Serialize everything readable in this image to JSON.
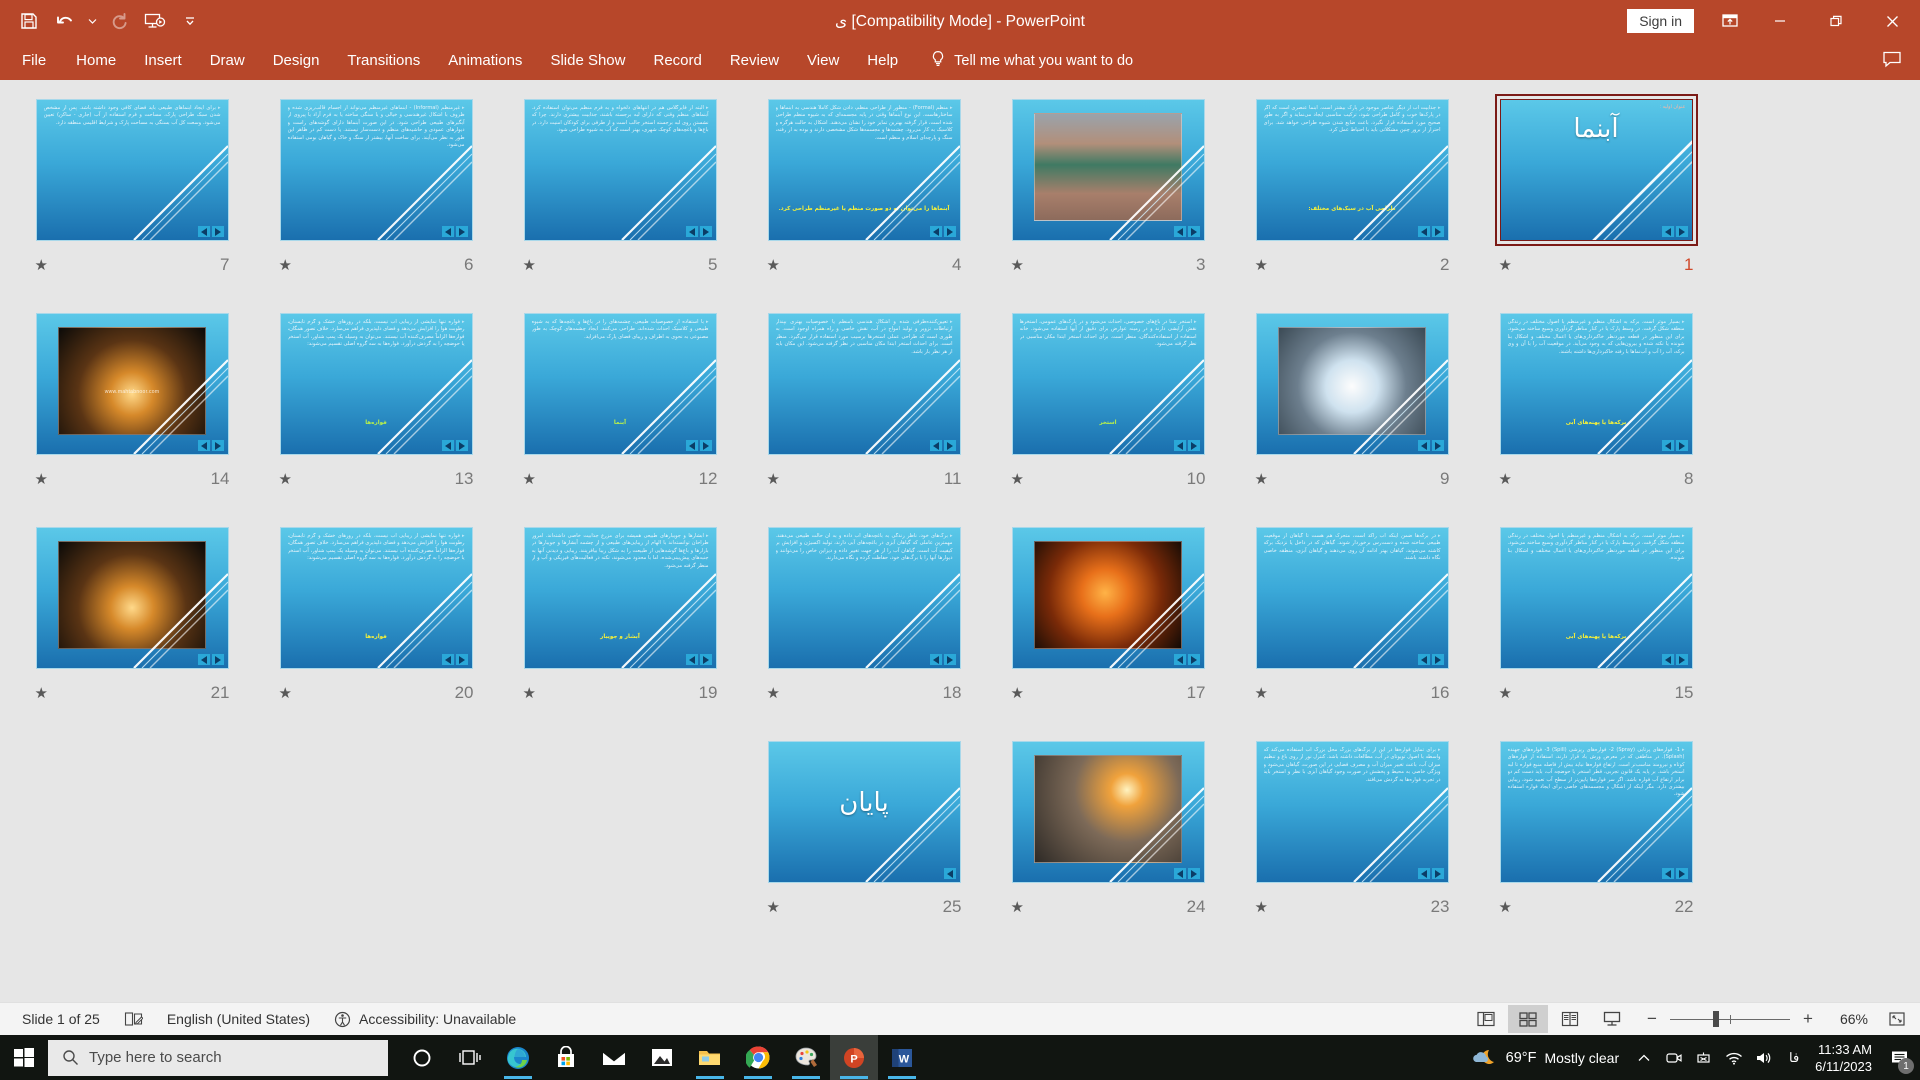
{
  "titlebar": {
    "document_title": "ی [Compatibility Mode]  -  PowerPoint",
    "sign_in": "Sign in",
    "quick_access": [
      {
        "name": "save-icon",
        "label": "Save"
      },
      {
        "name": "undo-icon",
        "label": "Undo"
      },
      {
        "name": "undo-dropdown-icon",
        "label": "Undo options"
      },
      {
        "name": "redo-icon",
        "label": "Redo"
      },
      {
        "name": "start-from-beginning-icon",
        "label": "Start From Beginning"
      },
      {
        "name": "customize-quick-access-toolbar-icon",
        "label": "Customize Quick Access Toolbar"
      }
    ],
    "window_controls": [
      {
        "name": "ribbon-display-options-icon",
        "label": "Ribbon Display Options"
      },
      {
        "name": "minimize-icon",
        "label": "Minimize"
      },
      {
        "name": "restore-icon",
        "label": "Restore Down"
      },
      {
        "name": "close-icon",
        "label": "Close"
      }
    ]
  },
  "ribbon": {
    "tabs": [
      "File",
      "Home",
      "Insert",
      "Draw",
      "Design",
      "Transitions",
      "Animations",
      "Slide Show",
      "Record",
      "Review",
      "View",
      "Help"
    ],
    "tell_me": "Tell me what you want to do",
    "comments_label": "Comments"
  },
  "statusbar": {
    "slide_indicator": "Slide 1 of 25",
    "language": "English (United States)",
    "accessibility": "Accessibility: Unavailable",
    "zoom_percent": "66%",
    "views": [
      {
        "name": "normal-view-button",
        "label": "Normal",
        "active": false
      },
      {
        "name": "slide-sorter-view-button",
        "label": "Slide Sorter",
        "active": true
      },
      {
        "name": "reading-view-button",
        "label": "Reading View",
        "active": false
      },
      {
        "name": "slide-show-button",
        "label": "Slide Show",
        "active": false
      }
    ],
    "fit_label": "Fit slide to current window"
  },
  "taskbar": {
    "search_placeholder": "Type here to search",
    "weather_temp": "69°F",
    "weather_desc": "Mostly clear",
    "time": "11:33 AM",
    "date": "6/11/2023",
    "notification_count": "1",
    "apps": [
      {
        "name": "cortana-icon",
        "label": "Cortana"
      },
      {
        "name": "task-view-icon",
        "label": "Task View"
      },
      {
        "name": "microsoft-edge-icon",
        "label": "Microsoft Edge"
      },
      {
        "name": "microsoft-store-icon",
        "label": "Microsoft Store"
      },
      {
        "name": "mail-icon",
        "label": "Mail"
      },
      {
        "name": "photos-icon",
        "label": "Photos"
      },
      {
        "name": "file-explorer-icon",
        "label": "File Explorer"
      },
      {
        "name": "google-chrome-icon",
        "label": "Google Chrome"
      },
      {
        "name": "paint-3d-icon",
        "label": "Paint 3D"
      },
      {
        "name": "powerpoint-icon",
        "label": "PowerPoint"
      },
      {
        "name": "word-icon",
        "label": "Word"
      }
    ],
    "tray": [
      {
        "name": "show-hidden-icons-icon",
        "label": "Show hidden icons"
      },
      {
        "name": "camera-icon",
        "label": "Camera"
      },
      {
        "name": "network-disconnected-icon",
        "label": "Network"
      },
      {
        "name": "wifi-icon",
        "label": "Wi-Fi"
      },
      {
        "name": "volume-icon",
        "label": "Volume"
      },
      {
        "name": "language-icon",
        "label": "فا"
      }
    ]
  },
  "sorter": {
    "selected_slide": 1,
    "slides": [
      {
        "n": 7,
        "kind": "text",
        "body": "برای ایجاد آبنماهای طبیعی باید فضای کافی وجود داشته باشد. پس از مشخص شدن سبک طراحی پارک، مساحت و فرم استفاده از آب (جاری - ساکن) تعیین می‌شود. وسعت کل آب بستگی به مساحت پارک و شرایط اقلیمی منطقه دارد.",
        "subhead": "",
        "subhead_color": ""
      },
      {
        "n": 6,
        "kind": "text",
        "body": "غیرمنظم (Informal) - آبنماهای غیرمنظم می‌تواند از اجسام قالب‌ریزی شده و ظروف با اشکال غیرهندسی و خیالی و یا سنگی ساخته یا به فرم آزاد با پیروی از آبگیرهای طبیعی طراحی شود. در این صورت آبنماها دارای گوشه‌های راست و دیوارهای عمودی و حاشیه‌های منظم و دست‌ساز نیستند. یا دست کم در ظاهر این طور به نظر می‌آیند. برای ساخت آنها، بیشتر از سنگ و خاک و گیاهان بومی استفاده می‌شود.",
        "subhead": "",
        "subhead_color": ""
      },
      {
        "n": 5,
        "kind": "text",
        "body": "البته از فایرگلاس هم در انتهاهای دلخواه و به فرم منظم می‌توان استفاده کرد. آبنماهای منظم وقتی که دارای لبه برجسته باشند، جذابیت بیشتری دارند. چرا که نشستن روی لبه برجسته استخر جالب است و از طرفی برای کودکان امنیت دارد. در باغ‌ها و باغچه‌های کوچک شهری، بهتر است که آب به شیوه طراحی شود.",
        "subhead": "",
        "subhead_color": ""
      },
      {
        "n": 4,
        "kind": "text",
        "body": "منظم (Formal) - منظور از طراحی منظم، دادن شکل کاملاً هندسی به آبنماها و ساختارهاست. این نوع آبنماها وقتی در پایه مجسمه‌ای که به شیوه منظم طراحی شده است، قرار گرفته بهترین تمایز خود را نشان می‌دهند. اشکال به حالت هرگره و کلاسیک به کار می‌رود. چشمه‌ها و مجسمه‌ها شکل مشخصی دارند و بوده به از رفته، سنگ و پارچه‌ای اسلام و منظم است.",
        "subhead": "آبنماها را می‌توان به دو صورت منظم یا غیرمنظم طراحی کرد.",
        "subhead_color": "yellow"
      },
      {
        "n": 3,
        "kind": "pic",
        "pic": "pic-a",
        "watermark": ""
      },
      {
        "n": 2,
        "kind": "text",
        "body": "جذابیت آب از دیگر عناصر موجود در پارک بیشتر است. آبنما عنصری است که اگر در پارک‌ها خوب و کامل طراحی شود، ترکیب مناسبی ایجاد می‌نماید و اگر به طور صحیح مورد استفاده قرار نگیرد، باعث ضایع شدن شیوه طراحی خواهد شد. برای احتراز از بروز چنین مشکلاتی باید با احتیاط عمل کرد.",
        "subhead": "طراحی آب در سبک‌های مختلف:",
        "subhead_color": "yellow"
      },
      {
        "n": 1,
        "kind": "title",
        "title": "آبنما",
        "corner": "عنوان اولیه :"
      },
      {
        "n": 14,
        "kind": "pic",
        "pic": "pic-c",
        "watermark": "www.mahtabnoor.com"
      },
      {
        "n": 13,
        "kind": "text",
        "body": "فواره تنها نمایشی از زیبایی آب نیست، بلکه در روزهای خشک و گرم تابستان، رطوبت هوا را افزایش می‌دهد و فضای دلپذیری فراهم می‌سازد. خلاف تصور همگان، فواره‌ها الزاماً مصرف‌کننده آب نیستند. می‌توان به وسیله یک پمپ شناور، آب استخر یا حوضچه را به گردش درآورد. فواره‌ها به سه گروه اصلی تقسیم می‌شوند:",
        "subhead": "فواره‌ها",
        "subhead_color": "green"
      },
      {
        "n": 12,
        "kind": "text",
        "body": "با استفاده از خصوصیات طبیعی، چشمه‌های را در باغ‌ها و باغچه‌ها که به شیوه طبیعی و کلاسیک احداث شده‌اند، طراحی می‌کنند. ایجاد چشمه‌های کوچک به طور مصنوعی به نحوی به اطراف و زیبای فضای پارک می‌افزاید.",
        "subhead": "آبنما",
        "subhead_color": "green"
      },
      {
        "n": 11,
        "kind": "text",
        "body": "تعیین‌کننده‌ظرفی شده و اشکال هندسی نامنظم یا خصوصیات بهتری بپندار ارتباطات تزویر و تولید امواج در آب، نقش خاصی و راه همراه اوجود است. به طوری است که طراحی عملی استخرها برسیب مورد استفاده قرار می‌گیرد. منظر است. برای احداث استخر ابتدا مکان مناسبی در نظر گرفته می‌شود. این مکان باید از هر نظر باز باشد.",
        "subhead": "",
        "subhead_color": ""
      },
      {
        "n": 10,
        "kind": "text",
        "body": "استخر شنا در باغ‌های خصوصی، احداث می‌شود و در پارک‌های عمومی، استخرها نقش آرایشی دارند و در زمینه عوارض برای دقیق از آبها استفاده می‌شود. خانه استفاده از استفاده‌کنندگان، منظر است. برای احداث استخر ابتدا مکان مناسبی در نظر گرفته می‌شود.",
        "subhead": "استخر",
        "subhead_color": "green"
      },
      {
        "n": 9,
        "kind": "pic",
        "pic": "pic-b",
        "watermark": ""
      },
      {
        "n": 8,
        "kind": "text",
        "body": "بسیار موثر است. برکه به اشکال منظم و غیرمنظم با اصول مختلف در زندگی منطقه شکل گرفت. در وسط پارک یا در کنار مناظر گردآوری وسیع ساخته می‌شود. برای این منظور در قطعه موردنظر خاکبرداری‌های یا اعمال مختلف و اشکال بنا شونده یا نکته شده و بیرون‌هایی که به وجود می‌آید. در موقعیت آب را با آن و وی برکه، آب را آب و آب‌نماها با رفته خاکبرداری‌ها داشته باشند.",
        "subhead": "برکه‌ها یا پهنه‌های آبی",
        "subhead_color": "yellow"
      },
      {
        "n": 21,
        "kind": "pic",
        "pic": "pic-c",
        "watermark": ""
      },
      {
        "n": 20,
        "kind": "text",
        "body": "فواره تنها نمایشی از زیبایی آب نیست، بلکه در روزهای خشک و گرم تابستان، رطوبت هوا را افزایش می‌دهد و فضای دلپذیری فراهم می‌سازد. خلاف تصور همگان، فواره‌ها الزاماً مصرف‌کننده آب نیستند. می‌توان به وسیله یک پمپ شناور، آب استخر یا حوضچه را به گردش درآورد. فواره‌ها به سه گروه اصلی تقسیم می‌شوند:",
        "subhead": "فواره‌ها",
        "subhead_color": "yellow"
      },
      {
        "n": 19,
        "kind": "text",
        "body": "آبشارها و جویبارهای طبیعی همیشه برای مزرع جذابیت خاصی داشته‌اند. امروز طراحان توانسته‌اند با الهام از زیبایی‌های طبیعی و از چشمه آبشارها و جویبارها در بازارها و باغ‌ها گوشه‌هایی از طبیعت را به شکل زیبا بیافرینند. زیبایی و دیدنی آنها به جنبه‌های پیش‌بینی‌شده، اما با محدود می‌شوند، نکته در فعالیت‌های فیزیکی و آب و از منظر گرفته می‌شود.",
        "subhead": "آبشار و جویبار",
        "subhead_color": "yellow"
      },
      {
        "n": 18,
        "kind": "text",
        "body": "برگ‌های خود، ناظر زندگی به باغچه‌های آب داده و به آن حالت طبیعی می‌دهند. مهمترین عاملی که گیاهان آبزی در باغچه‌های آبی دارند، تولید اکسیژن و افزایش بر کیفیت آب است. گیاهان آب را از هر جهت تغییر داده و دیزاین خاص را می‌توانند و دیوارها آنها را با برگ‌های خود، حفاظت کرده و نگاه می‌دارند.",
        "subhead": "",
        "subhead_color": ""
      },
      {
        "n": 17,
        "kind": "pic",
        "pic": "pic-d",
        "watermark": ""
      },
      {
        "n": 16,
        "kind": "text",
        "body": "در برکه‌ها ضمن اینکه آب راکد است، متحرک هم هست تا گیاهان از موقعیت طبیعی ساخته شده و دست‌رس برخوردار شوند. گیاهان که در داخل یا نزدیک برکه کاشته می‌شوند، گیاهان بهتر ادامه آن روی می‌دهند و گیاهان آبزی، منطقه خاصی نگاه داشته باشند.",
        "subhead": "",
        "subhead_color": ""
      },
      {
        "n": 15,
        "kind": "text",
        "body": "بسیار موثر است. برکه به اشکال منظم و غیرمنظم با اصول مختلف در زندگی منطقه شکل گرفت. در وسط پارک یا در کنار مناظر گردآوری وسیع ساخته می‌شود. برای این منظور در قطعه موردنظر خاکبرداری‌های یا اعمال مختلف و اشکال بنا شونده.",
        "subhead": "برکه‌ها یا پهنه‌های آبی",
        "subhead_color": "yellow"
      },
      {
        "n": 25,
        "kind": "title",
        "title": "پایان",
        "corner": ""
      },
      {
        "n": 24,
        "kind": "pic",
        "pic": "pic-f",
        "watermark": ""
      },
      {
        "n": 23,
        "kind": "text",
        "body": "برای تمایل فواره‌ها در این از برگ‌های بزرگ محل بزرگ آب استفاده می‌کند که واسطه با اصول تویوتای در آب، مطالعات داشته باشد. کنترل نور از روی باغ و تنظیم میزان آب، باعث تغییر میزان آب و مصرف فضایی در این صورت، گیاهان می‌شود و ویژگی خاصی به محیط و پخشش در صورت وجود گیاهان آبزی با نظر و استخر باید در تجربه فواره‌ها به گردش می‌افتد.",
        "subhead": "",
        "subhead_color": ""
      },
      {
        "n": 22,
        "kind": "text",
        "body": "1- فواره‌های پرتابی (Spray) 2- فواره‌های ریزشی (Spill) 3- فواره‌های جهنده (Splash). در مناطقی که در معرض وزش باد قرار دارند، استفاده از فواره‌های کوتاه و نیرومند مناسب‌تر است. ارتفاع فواره‌ها نباید بیش از فاصله منبع فواره تا لبه استخر باشد. بر پایه یک قانون تجربی، قطر استخر یا حوضچه آب، باید دست کم دو برابر ارتفاع آب فواره باشد. اگر سر فواره‌ها پایین‌تر از سطح آب تعبیه شود، زیبایی بیشتری دارد. مگر اینکه از اشکال و مجسمه‌های خاصی برای ایجاد فواره استفاده شود.",
        "subhead": "",
        "subhead_color": ""
      }
    ]
  }
}
